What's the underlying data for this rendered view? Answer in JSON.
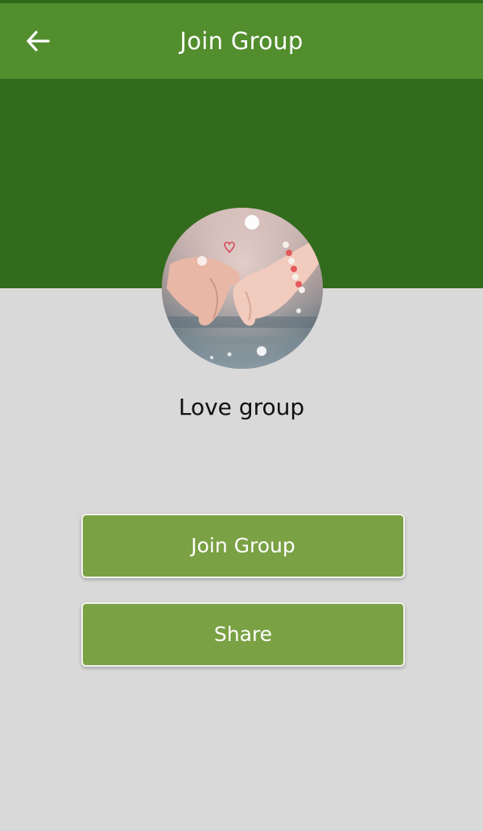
{
  "app_bar": {
    "title": "Join Group",
    "back_icon": "arrow-back-icon",
    "background": "#528e2d"
  },
  "hero": {
    "background": "#336b1c",
    "avatar_icon": "group-avatar-photo"
  },
  "group": {
    "name": "Love group"
  },
  "actions": {
    "join_label": "Join Group",
    "share_label": "Share",
    "button_color": "#7aa144"
  },
  "page": {
    "background": "#d9d9d9"
  }
}
